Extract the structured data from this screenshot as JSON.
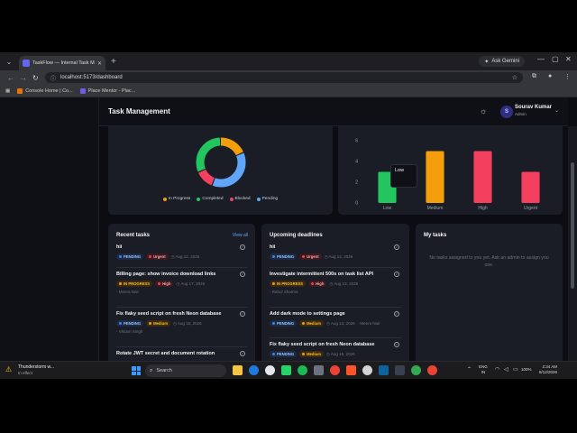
{
  "browser": {
    "tab_title": "TaskFlow — Internal Task Mana...",
    "url": "localhost:5173/dashboard",
    "gemini_label": "Ask Gemini",
    "bookmarks": [
      {
        "label": "Console Home | Co...",
        "color": "#e8710a"
      },
      {
        "label": "Place Mentor - Plac...",
        "color": "#6c5ce7"
      }
    ]
  },
  "app": {
    "page_title": "Task Management",
    "user": {
      "initial": "S",
      "name": "Sourav Kumar",
      "role": "Admin"
    }
  },
  "status_chart": {
    "legend": [
      {
        "label": "In Progress",
        "color": "#f59e0b"
      },
      {
        "label": "Completed",
        "color": "#22c55e"
      },
      {
        "label": "Blocked",
        "color": "#f43f5e"
      },
      {
        "label": "Pending",
        "color": "#60a5fa"
      }
    ]
  },
  "tooltip": {
    "label": "Low"
  },
  "chart_data": {
    "type": "bar",
    "categories": [
      "Low",
      "Medium",
      "High",
      "Urgent"
    ],
    "values": [
      3,
      5,
      5,
      3
    ],
    "colors": [
      "#22c55e",
      "#f59e0b",
      "#f43f5e",
      "#f43f5e"
    ],
    "y_ticks": [
      "0",
      "2",
      "4",
      "6"
    ],
    "ylim": [
      0,
      6
    ],
    "grid": false
  },
  "donut_data": {
    "type": "pie",
    "segments": [
      {
        "label": "In Progress",
        "value": 3,
        "color": "#f59e0b"
      },
      {
        "label": "Pending",
        "value": 6,
        "color": "#60a5fa"
      },
      {
        "label": "Blocked",
        "value": 2,
        "color": "#f43f5e"
      },
      {
        "label": "Completed",
        "value": 5,
        "color": "#22c55e"
      }
    ]
  },
  "recent": {
    "title": "Recent tasks",
    "view_all": "View all",
    "tasks": [
      {
        "title": "hii",
        "status": "PENDING",
        "priority": "Urgent",
        "date": "Aug 12, 2026",
        "assignee": ""
      },
      {
        "title": "Billing page: show invoice download links",
        "status": "IN PROGRESS",
        "priority": "High",
        "date": "Aug 17, 2026",
        "assignee": "Meera Nair"
      },
      {
        "title": "Fix flaky seed script on fresh Neon database",
        "status": "PENDING",
        "priority": "Medium",
        "date": "Aug 15, 2026",
        "assignee": "Vikram Singh"
      },
      {
        "title": "Rotate JWT secret and document rotation",
        "status": "",
        "priority": "",
        "date": "",
        "assignee": ""
      }
    ]
  },
  "upcoming": {
    "title": "Upcoming deadlines",
    "tasks": [
      {
        "title": "hii",
        "status": "PENDING",
        "priority": "Urgent",
        "date": "Aug 12, 2026",
        "assignee": ""
      },
      {
        "title": "Investigate intermittent 500s on task list API",
        "status": "IN PROGRESS",
        "priority": "High",
        "date": "Aug 13, 2026",
        "assignee": "Rahul Sharma"
      },
      {
        "title": "Add dark mode to settings page",
        "status": "PENDING",
        "priority": "Medium",
        "date": "Aug 14, 2026",
        "assignee": "Meera Nair"
      },
      {
        "title": "Fix flaky seed script on fresh Neon database",
        "status": "PENDING",
        "priority": "Medium",
        "date": "Aug 15, 2026",
        "assignee": ""
      }
    ]
  },
  "mytasks": {
    "title": "My tasks",
    "empty": "No tasks assigned to you yet. Ask an admin to assign you one."
  },
  "taskbar": {
    "weather_title": "Thunderstorm w...",
    "weather_sub": "In effect",
    "search": "Search",
    "lang_1": "ENG",
    "lang_2": "IN",
    "battery": "100%",
    "time": "2:34 AM",
    "date": "8/12/2026"
  }
}
